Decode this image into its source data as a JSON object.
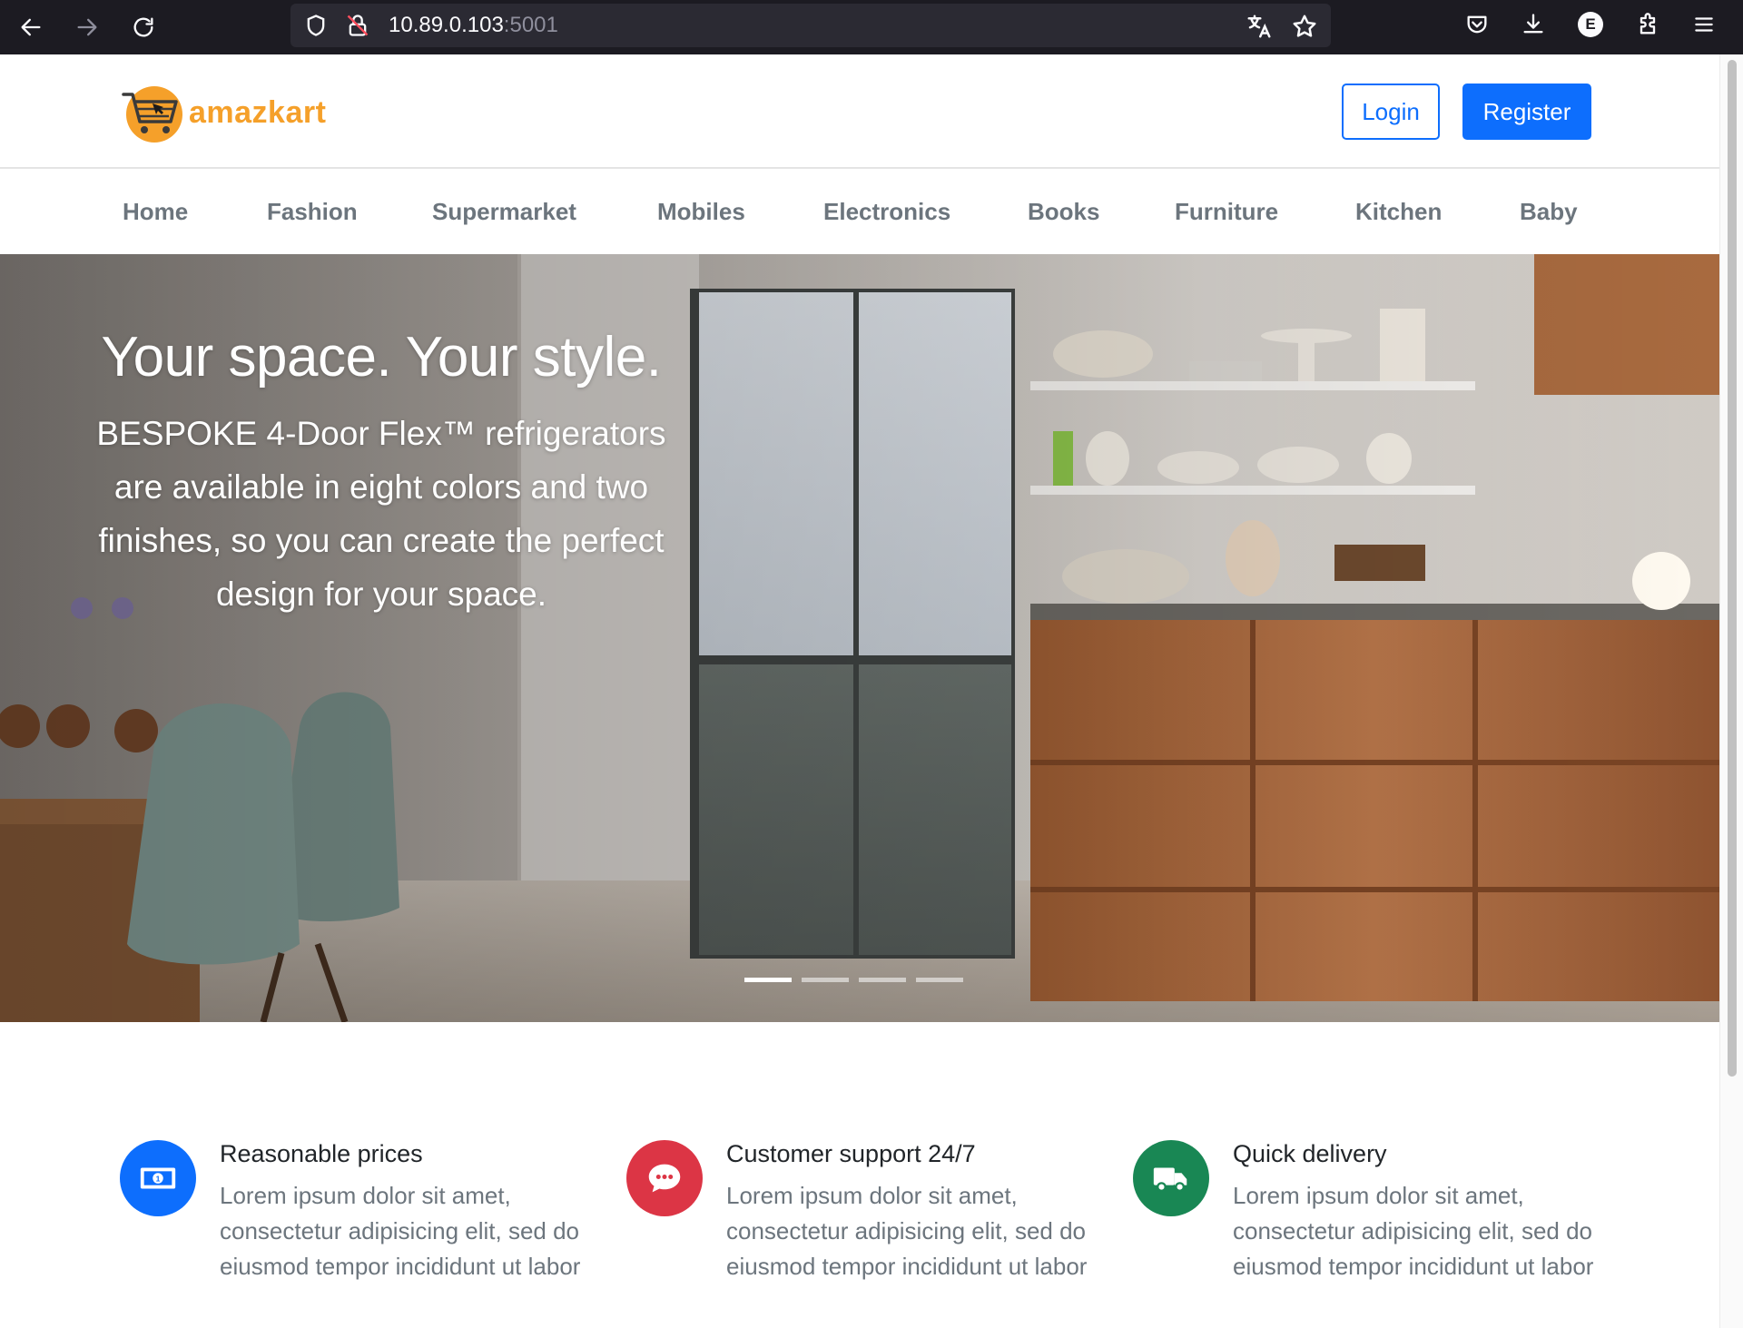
{
  "browser": {
    "url_host": "10.89.0.103",
    "url_port": ":5001"
  },
  "header": {
    "brand": "amazkart",
    "login_label": "Login",
    "register_label": "Register"
  },
  "categories": [
    "Home",
    "Fashion",
    "Supermarket",
    "Mobiles",
    "Electronics",
    "Books",
    "Furniture",
    "Kitchen",
    "Baby"
  ],
  "hero": {
    "title": "Your space. Your style.",
    "text": "BESPOKE 4-Door Flex™ refrigerators are available in eight colors and two finishes, so you can create the perfect design for your space.",
    "slides_total": 4,
    "active_slide": 1
  },
  "features": [
    {
      "title": "Reasonable prices",
      "text": "Lorem ipsum dolor sit amet, consectetur adipisicing elit, sed do eiusmod tempor incididunt ut labor",
      "icon": "cash-icon",
      "color": "#0d6efd"
    },
    {
      "title": "Customer support 24/7",
      "text": "Lorem ipsum dolor sit amet, consectetur adipisicing elit, sed do eiusmod tempor incididunt ut labor",
      "icon": "chat-icon",
      "color": "#dc3545"
    },
    {
      "title": "Quick delivery",
      "text": "Lorem ipsum dolor sit amet, consectetur adipisicing elit, sed do eiusmod tempor incididunt ut labor",
      "icon": "truck-icon",
      "color": "#198754"
    }
  ],
  "colors": {
    "primary": "#0d6efd",
    "brand_orange": "#f5a02a",
    "muted_text": "#6c757d"
  }
}
